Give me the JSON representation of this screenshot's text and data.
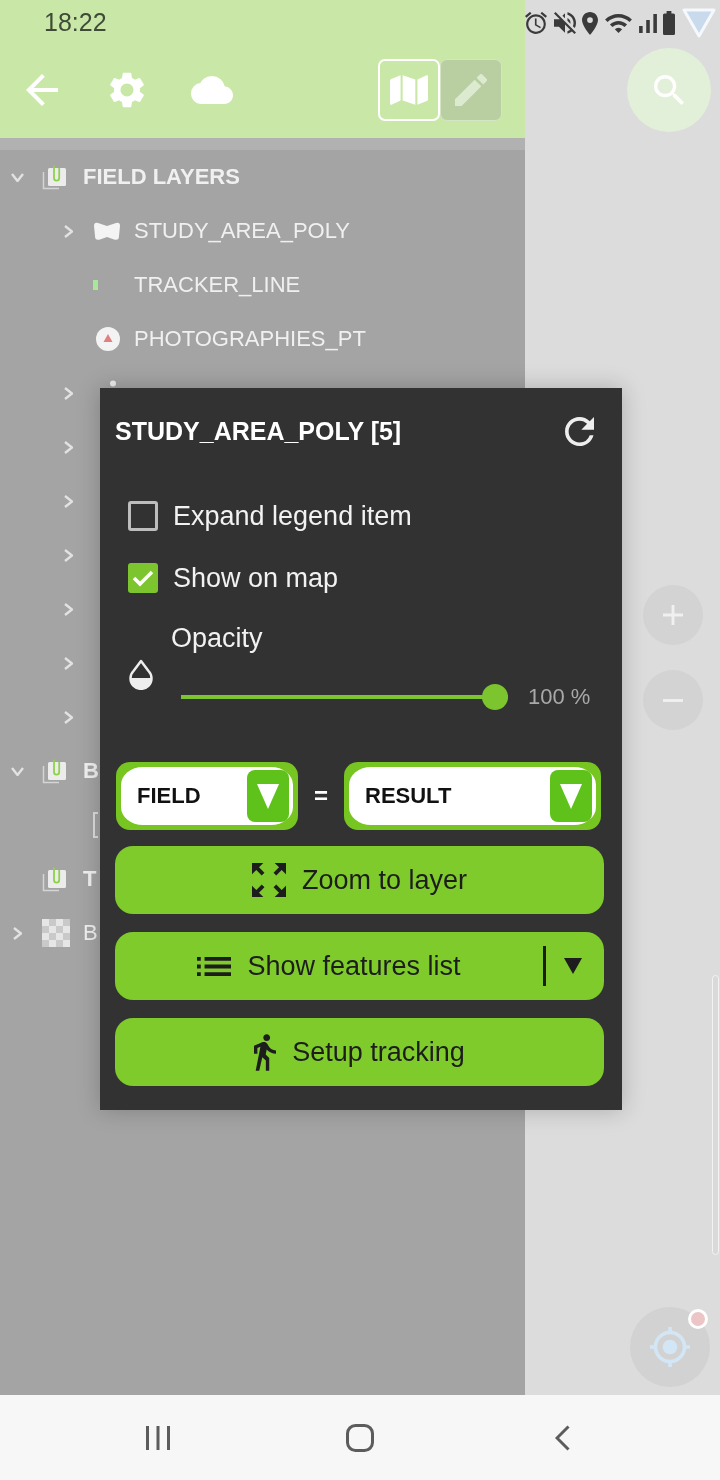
{
  "status_bar": {
    "time": "18:22"
  },
  "toolbar": {
    "view_modes": [
      {
        "kind": "map",
        "selected": true
      },
      {
        "kind": "edit",
        "selected": false
      }
    ]
  },
  "layer_tree": [
    {
      "label": "FIELD LAYERS",
      "kind": "group",
      "expanded": true,
      "children": [
        {
          "label": "STUDY_AREA_POLY",
          "kind": "polygon",
          "expanded": false
        },
        {
          "label": "TRACKER_LINE",
          "kind": "line"
        },
        {
          "label": "PHOTOGRAPHIES_PT",
          "kind": "point"
        },
        {
          "kind": "marker",
          "expanded": false
        },
        {
          "expanded": false
        },
        {
          "expanded": false
        },
        {
          "expanded": false
        },
        {
          "expanded": false
        },
        {
          "expanded": false
        },
        {
          "expanded": false
        }
      ]
    },
    {
      "label": "B",
      "kind": "group",
      "expanded": true,
      "children": [
        {
          "kind": "table"
        }
      ]
    },
    {
      "label": "T",
      "kind": "group"
    },
    {
      "label": "B",
      "kind": "basemap",
      "expanded": false
    }
  ],
  "layer_dialog": {
    "title": "STUDY_AREA_POLY [5]",
    "options": [
      {
        "label": "Expand legend item",
        "checked": false
      },
      {
        "label": "Show on map",
        "checked": true
      }
    ],
    "opacity": {
      "label": "Opacity",
      "level": 1,
      "reading": "100 %"
    },
    "filter": {
      "field": "FIELD",
      "operator": "=",
      "value": "RESULT"
    },
    "actions": [
      {
        "label": "Zoom to layer",
        "kind": "zoom",
        "has_menu": false
      },
      {
        "label": "Show features list",
        "kind": "list",
        "has_menu": true
      },
      {
        "label": "Setup tracking",
        "kind": "tracking",
        "has_menu": false
      }
    ]
  }
}
